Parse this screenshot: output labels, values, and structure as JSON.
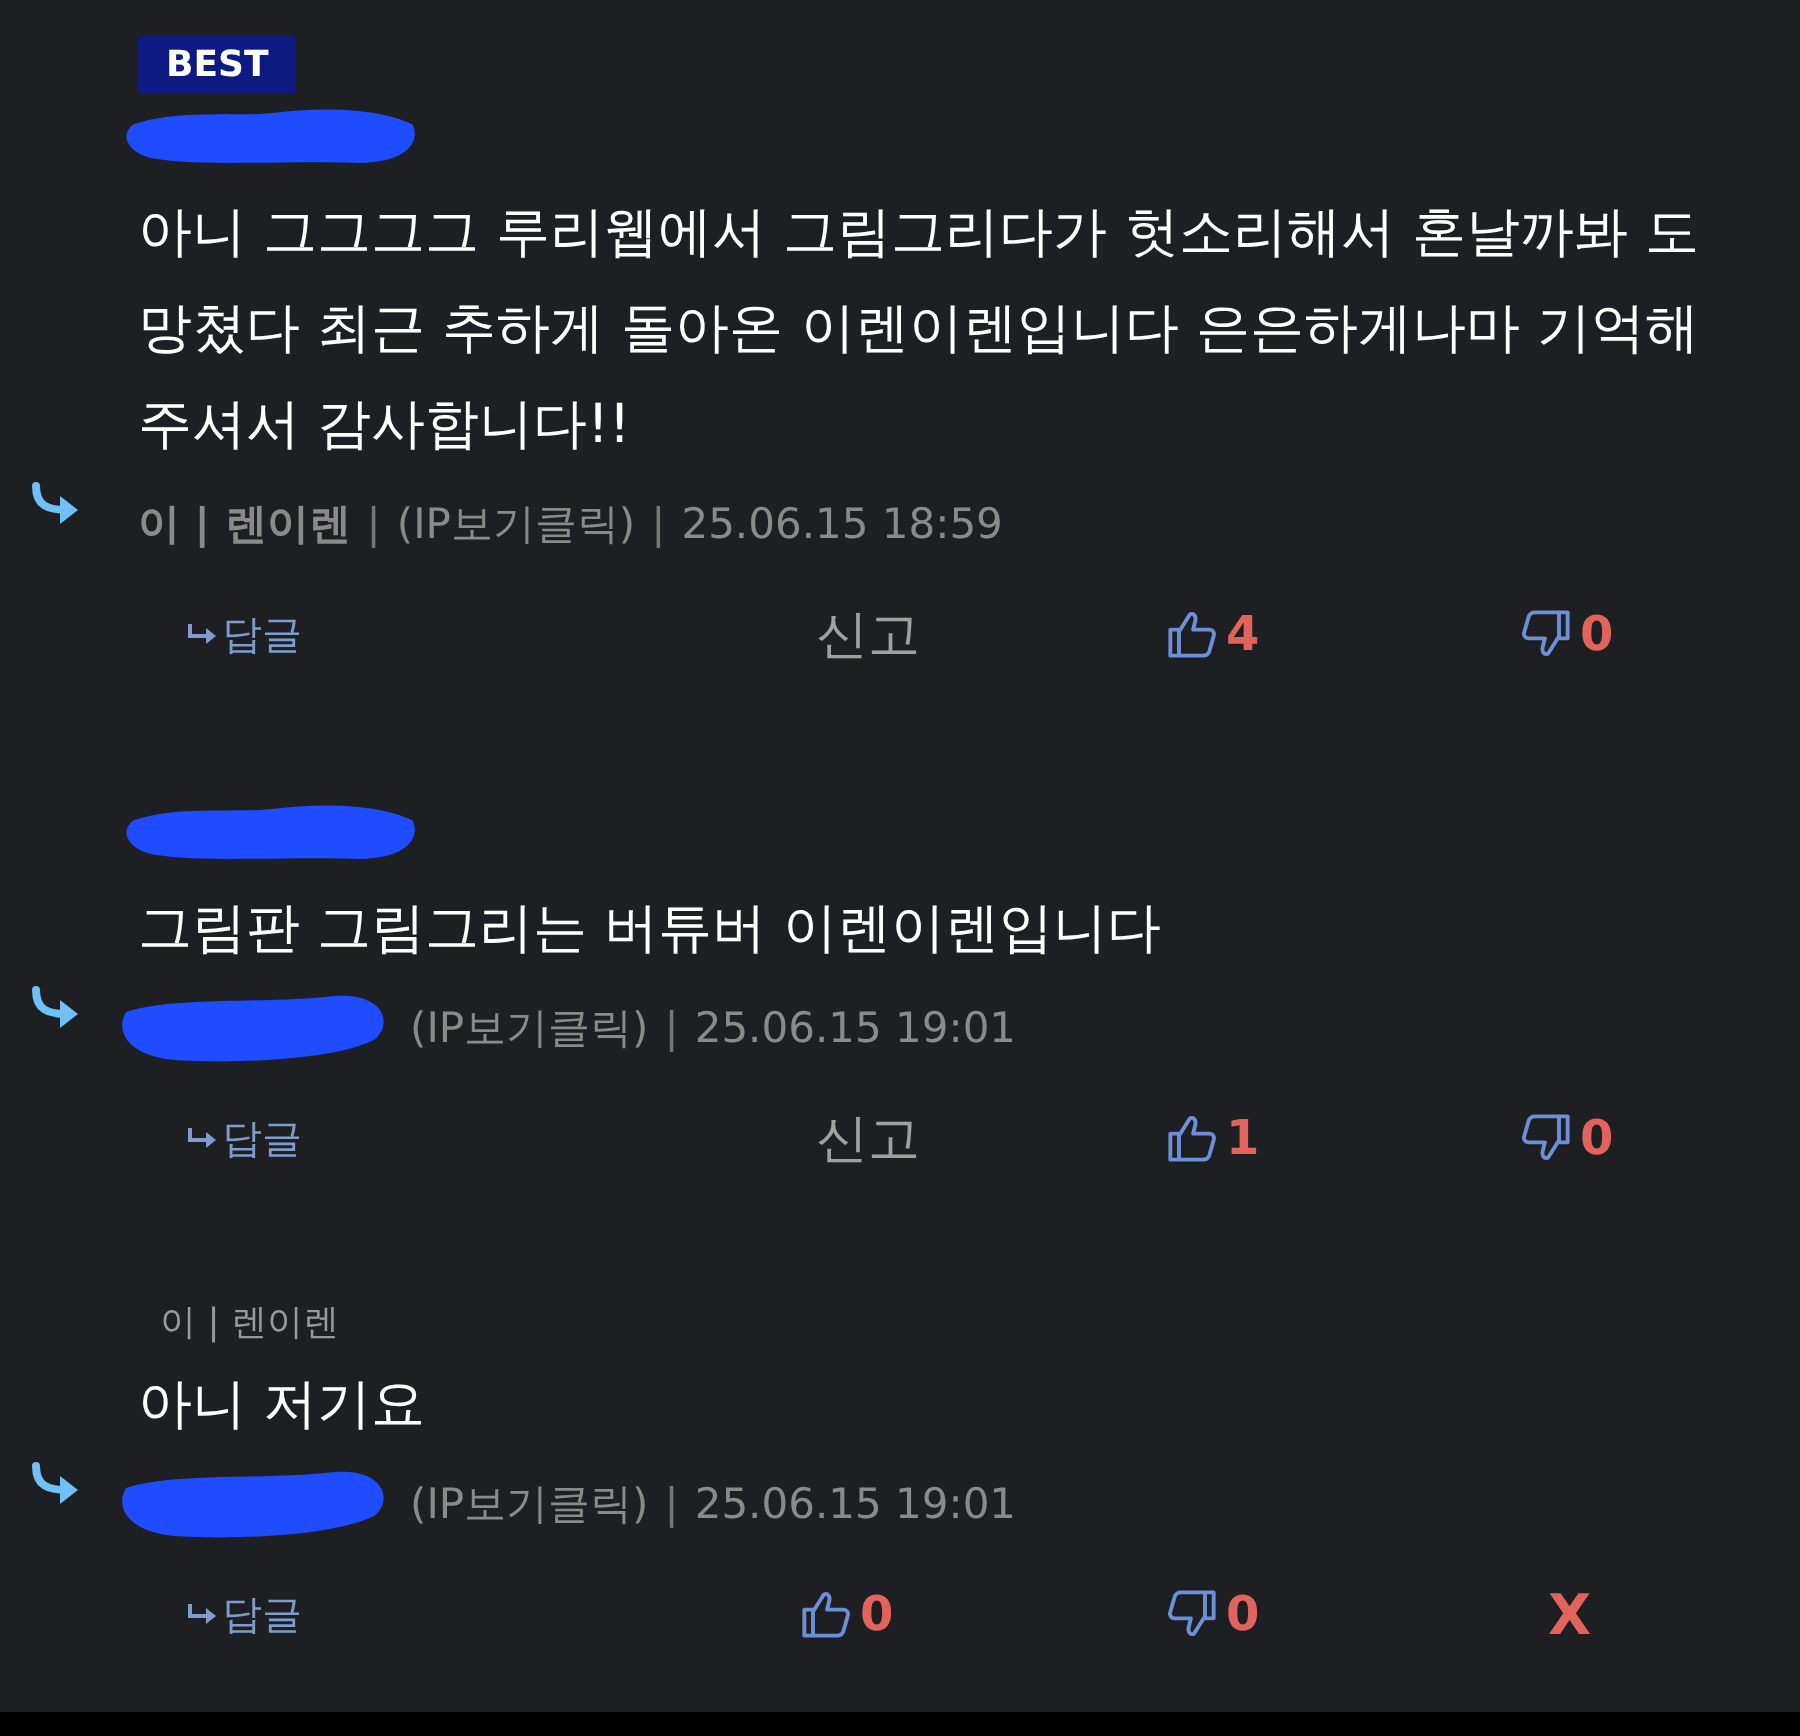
{
  "comments": [
    {
      "badge": "BEST",
      "name_redacted": true,
      "body": "아니 그그그그 루리웹에서 그림그리다가 헛소리해서 혼날까봐 도망쳤다 최근 추하게 돌아온 이렌이렌입니다 은은하게나마 기억해 주셔서 감사합니다!!",
      "meta_redacted": false,
      "meta": [
        {
          "kind": "author",
          "text": "이 | 렌이렌"
        },
        {
          "kind": "separator",
          "text": "|"
        },
        {
          "kind": "ip",
          "text": "(IP보기클릭)"
        },
        {
          "kind": "separator",
          "text": "|"
        },
        {
          "kind": "date",
          "text": "25.06.15 18:59"
        }
      ],
      "actions": [
        {
          "kind": "reply",
          "label": "답글"
        },
        {
          "kind": "report",
          "label": "신고"
        },
        {
          "kind": "like",
          "count": "4"
        },
        {
          "kind": "dislike",
          "count": "0"
        }
      ]
    },
    {
      "name_redacted": true,
      "body": "그림판 그림그리는 버튜버 이렌이렌입니다",
      "meta_redacted": true,
      "meta": [
        {
          "kind": "ip",
          "text": "(IP보기클릭)"
        },
        {
          "kind": "separator",
          "text": "|"
        },
        {
          "kind": "date",
          "text": "25.06.15 19:01"
        }
      ],
      "actions": [
        {
          "kind": "reply",
          "label": "답글"
        },
        {
          "kind": "report",
          "label": "신고"
        },
        {
          "kind": "like",
          "count": "1"
        },
        {
          "kind": "dislike",
          "count": "0"
        }
      ]
    },
    {
      "name_redacted": false,
      "quoted_author": "이 | 렌이렌",
      "body": "아니 저기요",
      "meta_redacted": true,
      "meta": [
        {
          "kind": "ip",
          "text": "(IP보기클릭)"
        },
        {
          "kind": "separator",
          "text": "|"
        },
        {
          "kind": "date",
          "text": "25.06.15 19:01"
        }
      ],
      "actions": [
        {
          "kind": "reply",
          "label": "답글"
        },
        {
          "kind": "like",
          "count": "0"
        },
        {
          "kind": "dislike",
          "count": "0"
        },
        {
          "kind": "delete",
          "label": "X"
        }
      ]
    }
  ]
}
